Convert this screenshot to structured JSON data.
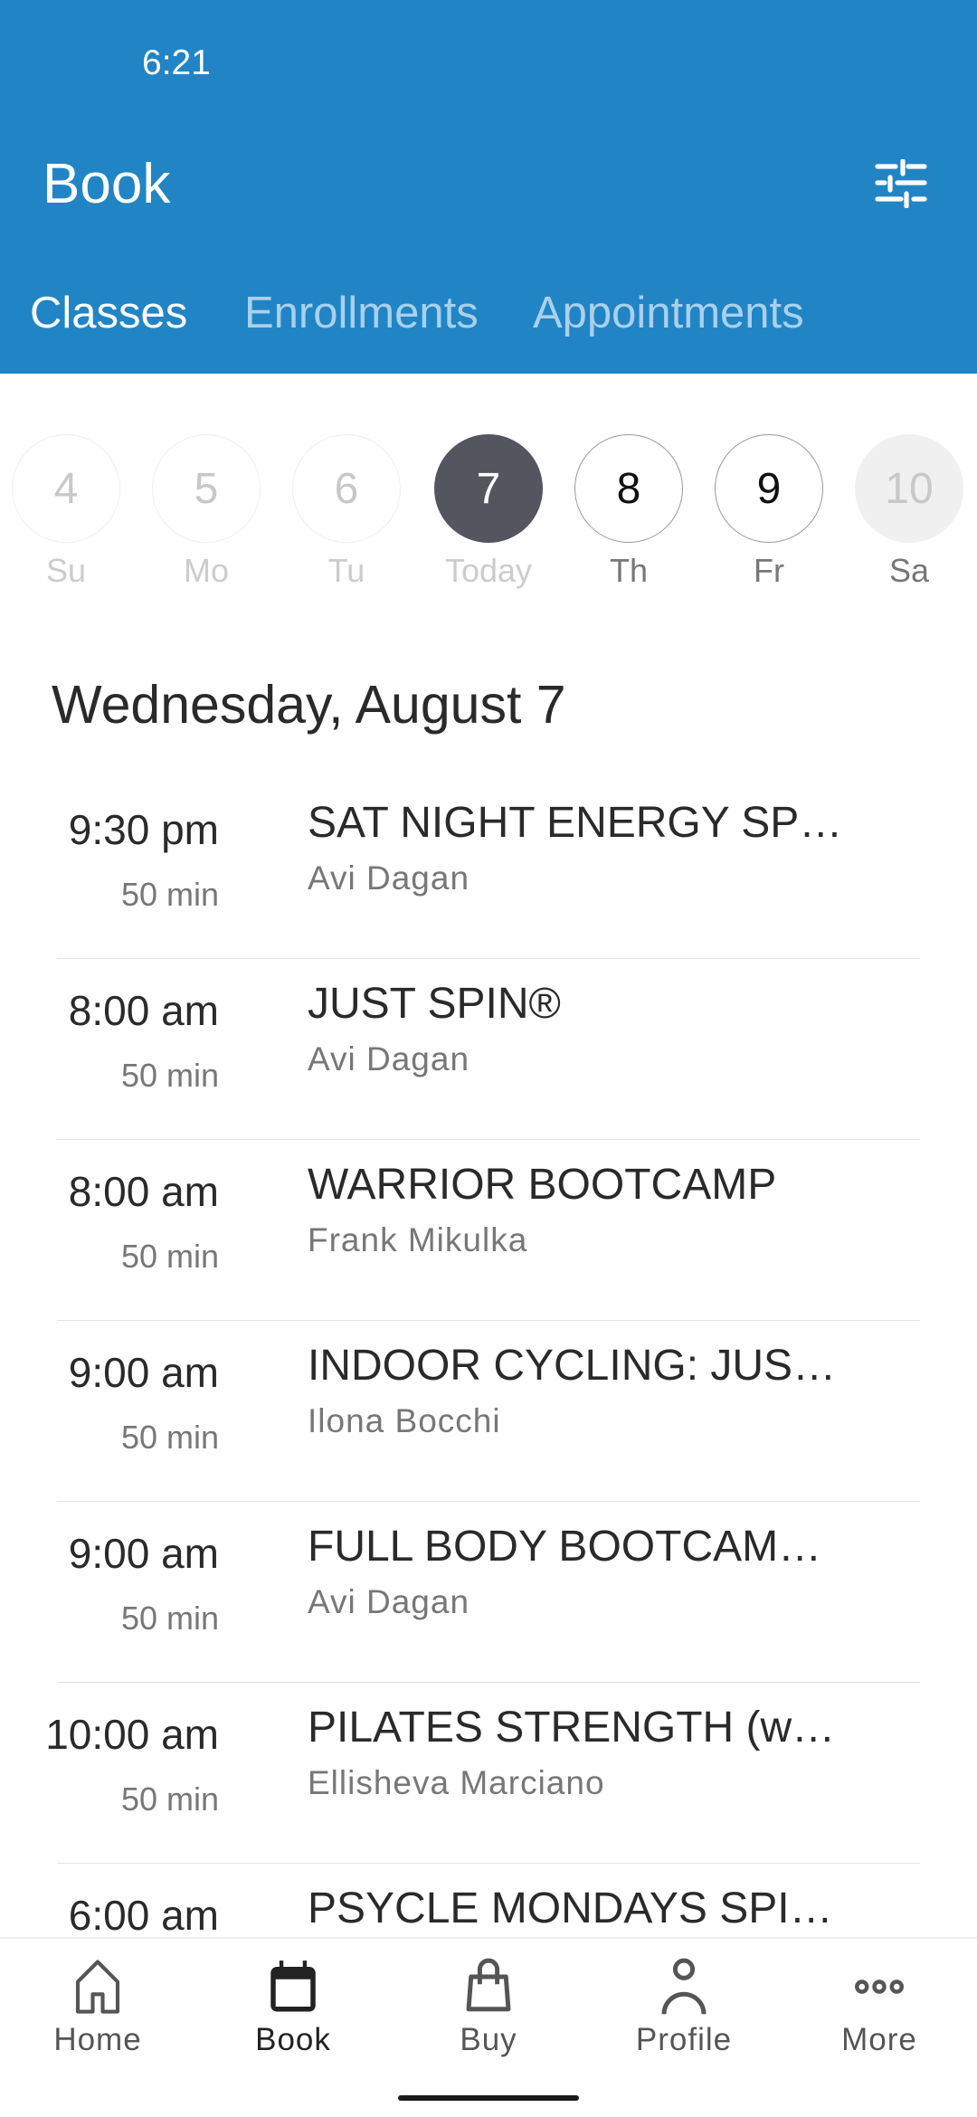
{
  "status_bar": {
    "time": "6:21"
  },
  "header": {
    "title": "Book",
    "filter_icon": "sliders-icon",
    "color": "#2185c5"
  },
  "tabs": [
    {
      "label": "Classes",
      "active": true
    },
    {
      "label": "Enrollments"
    },
    {
      "label": "Appointments"
    }
  ],
  "days": [
    {
      "num": "4",
      "label": "Su",
      "state": "past"
    },
    {
      "num": "5",
      "label": "Mo",
      "state": "past"
    },
    {
      "num": "6",
      "label": "Tu",
      "state": "past"
    },
    {
      "num": "7",
      "label": "Today",
      "state": "today"
    },
    {
      "num": "8",
      "label": "Th",
      "state": "future"
    },
    {
      "num": "9",
      "label": "Fr",
      "state": "future"
    },
    {
      "num": "10",
      "label": "Sa",
      "state": "sat"
    }
  ],
  "date_heading": "Wednesday, August 7",
  "classes": [
    {
      "time": "9:30 pm",
      "duration": "50 min",
      "name": "SAT NIGHT ENERGY SP…",
      "instructor": "Avi Dagan"
    },
    {
      "time": "8:00 am",
      "duration": "50 min",
      "name": "JUST SPIN®",
      "instructor": "Avi Dagan"
    },
    {
      "time": "8:00 am",
      "duration": "50 min",
      "name": "WARRIOR BOOTCAMP",
      "instructor": "Frank Mikulka"
    },
    {
      "time": "9:00 am",
      "duration": "50 min",
      "name": "INDOOR CYCLING: JUS…",
      "instructor": "Ilona Bocchi"
    },
    {
      "time": "9:00 am",
      "duration": "50 min",
      "name": "FULL BODY BOOTCAM…",
      "instructor": "Avi Dagan"
    },
    {
      "time": "10:00 am",
      "duration": "50 min",
      "name": "PILATES STRENGTH (w…",
      "instructor": "Ellisheva Marciano"
    },
    {
      "time": "6:00 am",
      "duration": "",
      "name": "PSYCLE MONDAYS SPI…",
      "instructor": ""
    }
  ],
  "nav": [
    {
      "label": "Home",
      "icon": "home-icon"
    },
    {
      "label": "Book",
      "icon": "calendar-icon",
      "active": true
    },
    {
      "label": "Buy",
      "icon": "shopping-bag-icon"
    },
    {
      "label": "Profile",
      "icon": "person-icon"
    },
    {
      "label": "More",
      "icon": "more-dots-icon"
    }
  ]
}
